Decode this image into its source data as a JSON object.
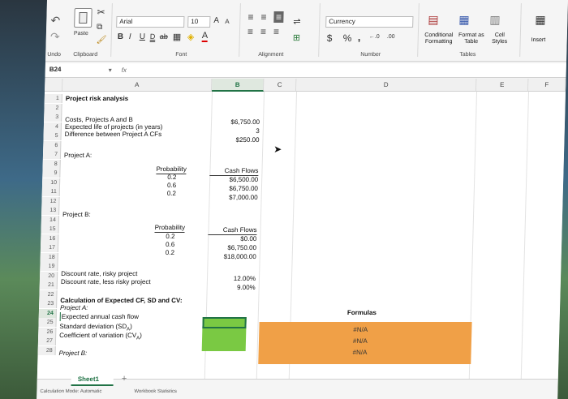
{
  "ribbon": {
    "undo_label": "Undo",
    "paste_label": "Paste",
    "clipboard_label": "Clipboard",
    "font_name": "Arial",
    "font_size": "10",
    "font_label": "Font",
    "bold": "B",
    "italic": "I",
    "underline": "U",
    "grow_font": "A",
    "shrink_font": "A",
    "alignment_label": "Alignment",
    "number_format": "Currency",
    "currency_symbol": "$",
    "percent_symbol": "%",
    "comma_symbol": ",",
    "inc_decimal": "←.0",
    "dec_decimal": ".00",
    "number_label": "Number",
    "conditional_formatting": "Conditional Formatting",
    "format_as_table": "Format as Table",
    "cell_styles": "Cell Styles",
    "tables_label": "Tables",
    "insert_label": "Insert"
  },
  "formula_bar": {
    "name_box": "B24",
    "fx": "fx",
    "value": ""
  },
  "columns": [
    "A",
    "B",
    "C",
    "D",
    "E",
    "F"
  ],
  "rows": [
    "1",
    "2",
    "3",
    "4",
    "5",
    "6",
    "7",
    "8",
    "9",
    "10",
    "11",
    "12",
    "13",
    "14",
    "15",
    "16",
    "17",
    "18",
    "19",
    "20",
    "21",
    "22",
    "23",
    "24",
    "25",
    "26",
    "27",
    "28"
  ],
  "cells": {
    "a1": "Project risk analysis",
    "a3": "Costs, Projects A and B",
    "a4": "Expected life of projects (in years)",
    "a5": "Difference between Project A CFs",
    "b3": "$6,750.00",
    "b4": "3",
    "b5": "$250.00",
    "a7": "Project A:",
    "prob_hdr_a": "Probability",
    "a9": "0.2",
    "a10": "0.6",
    "a11": "0.2",
    "cf_hdr_a": "Cash Flows",
    "b9": "$6,500.00",
    "b10": "$6,750.00",
    "b11": "$7,000.00",
    "a13": "Project B:",
    "prob_hdr_b": "Probability",
    "a15": "0.2",
    "a16": "0.6",
    "a17": "0.2",
    "cf_hdr_b": "Cash Flows",
    "b15": "$0.00",
    "b16": "$6,750.00",
    "b17": "$18,000.00",
    "a19": "Discount rate, risky project",
    "a20": "Discount rate, less risky project",
    "b19": "12.00%",
    "b20": "9.00%",
    "a22": "Calculation of Expected CF, SD and CV:",
    "a23": "Project A:",
    "a24": "Expected annual cash flow",
    "a25": "Standard deviation (SD",
    "a25_sub": "A",
    "a25_close": ")",
    "a26": "Coefficient of variation (CV",
    "a26_sub": "A",
    "a26_close": ")",
    "a28": "Project B:",
    "formulas_hdr": "Formulas",
    "na1": "#N/A",
    "na2": "#N/A",
    "na3": "#N/A"
  },
  "sheet_tab": "Sheet1",
  "add_sheet": "+",
  "status": {
    "calc_mode": "Calculation Mode: Automatic",
    "workbook_stats": "Workbook Statistics"
  },
  "colors": {
    "accent_green": "#217346",
    "input_green": "#7ac943",
    "formula_orange": "#f0a047",
    "selection_border": "#217346"
  }
}
